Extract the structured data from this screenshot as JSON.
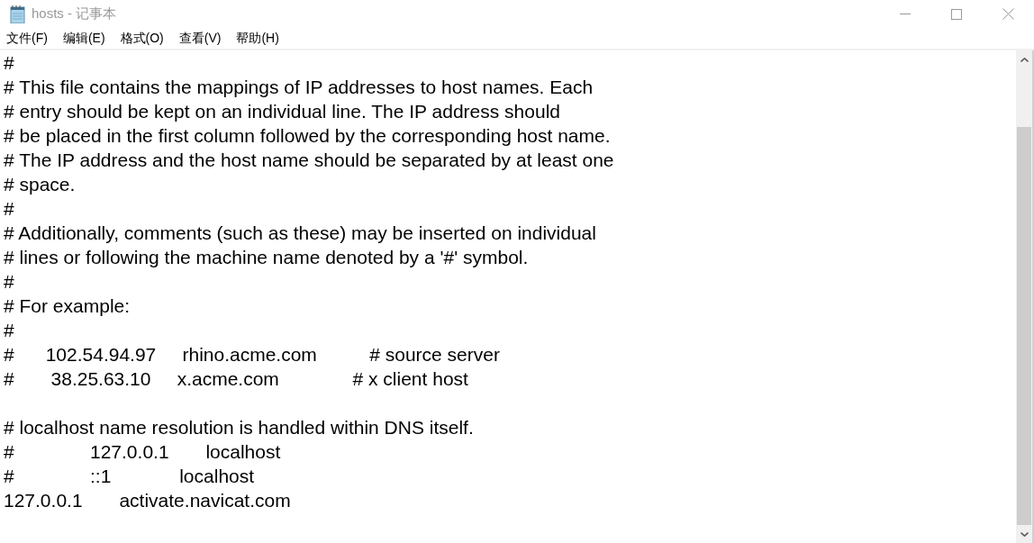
{
  "window": {
    "title": "hosts - 记事本"
  },
  "menu_bar": [
    {
      "label": "文件(F)"
    },
    {
      "label": "编辑(E)"
    },
    {
      "label": "格式(O)"
    },
    {
      "label": "查看(V)"
    },
    {
      "label": "帮助(H)"
    }
  ],
  "editor": {
    "blocks": [
      [
        "#",
        "# This file contains the mappings of IP addresses to host names. Each",
        "# entry should be kept on an individual line. The IP address should",
        "# be placed in the first column followed by the corresponding host name.",
        "# The IP address and the host name should be separated by at least one",
        "# space.",
        "#",
        "# Additionally, comments (such as these) may be inserted on individual",
        "# lines or following the machine name denoted by a '#' symbol.",
        "#",
        "# For example:",
        "#",
        "#      102.54.94.97     rhino.acme.com          # source server",
        "#       38.25.63.10     x.acme.com              # x client host"
      ],
      [
        "# localhost name resolution is handled within DNS itself.",
        "#\t127.0.0.1       localhost",
        "#\t::1             localhost",
        "127.0.0.1       activate.navicat.com"
      ]
    ]
  }
}
